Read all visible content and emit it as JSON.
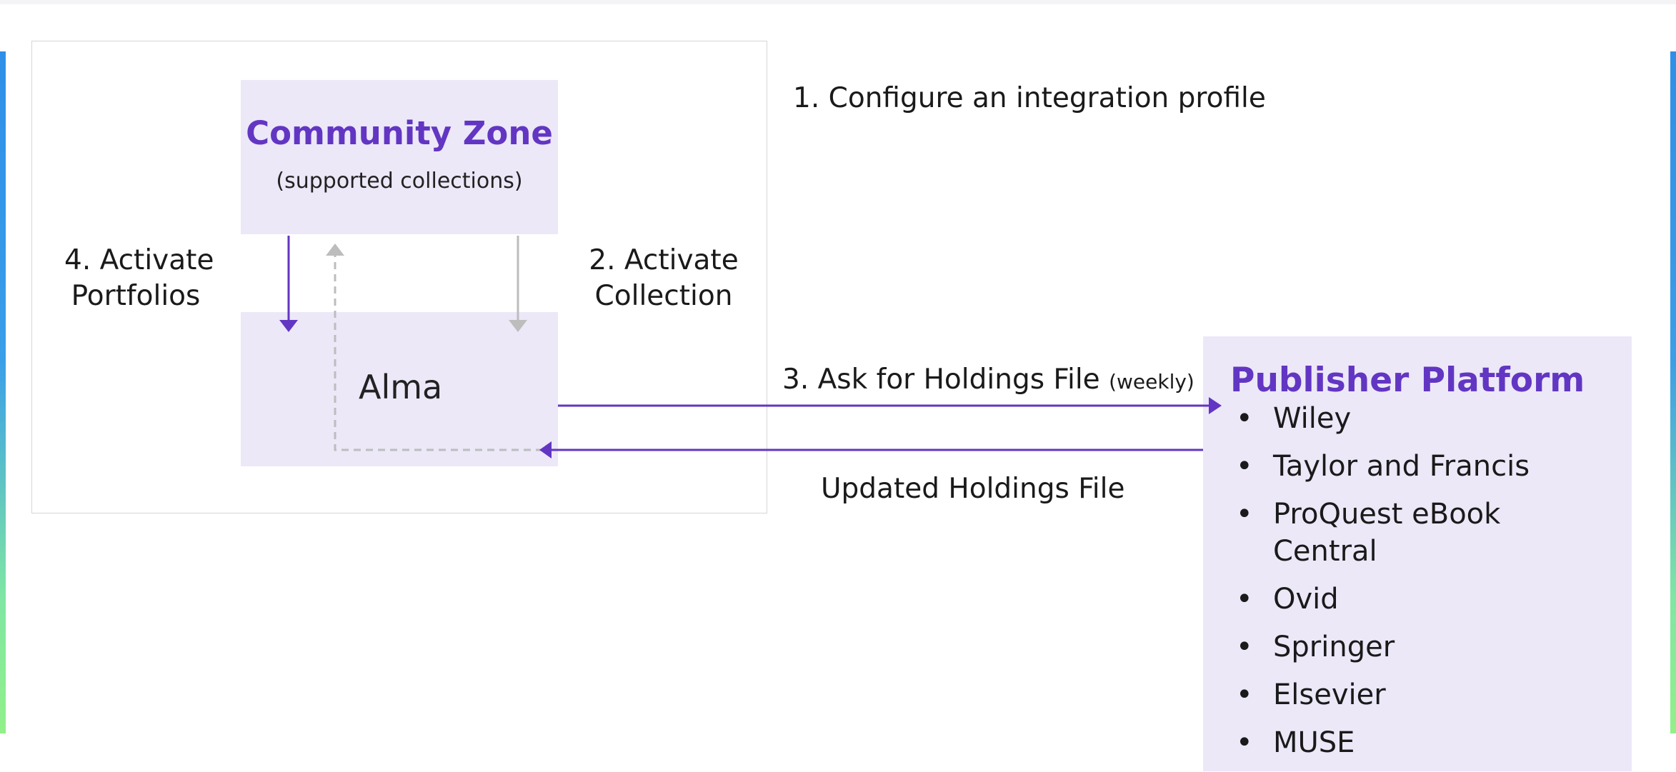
{
  "diagram": {
    "community_zone": {
      "title": "Community Zone",
      "subtitle": "(supported collections)"
    },
    "alma": {
      "label": "Alma"
    },
    "steps": {
      "step1": "1. Configure an integration profile",
      "step2_line1": "2. Activate",
      "step2_line2": "Collection",
      "step3": "3. Ask for Holdings File",
      "step3_small": "(weekly)",
      "step4_line1": "4. Activate",
      "step4_line2": "Portfolios",
      "updated": "Updated Holdings File"
    },
    "publisher_platform": {
      "title": "Publisher Platform",
      "items": [
        {
          "bullet": "•",
          "text": "Wiley"
        },
        {
          "bullet": "•",
          "text": "Taylor and Francis"
        },
        {
          "bullet": "•",
          "text": "ProQuest eBook Central"
        },
        {
          "bullet": "•",
          "text": "Ovid"
        },
        {
          "bullet": "•",
          "text": "Springer"
        },
        {
          "bullet": "•",
          "text": "Elsevier"
        },
        {
          "bullet": "•",
          "text": "MUSE"
        }
      ]
    },
    "colors": {
      "accent": "#6236c2",
      "box_fill": "#ece8f8",
      "grey_arrow": "#bdbdbd"
    }
  }
}
